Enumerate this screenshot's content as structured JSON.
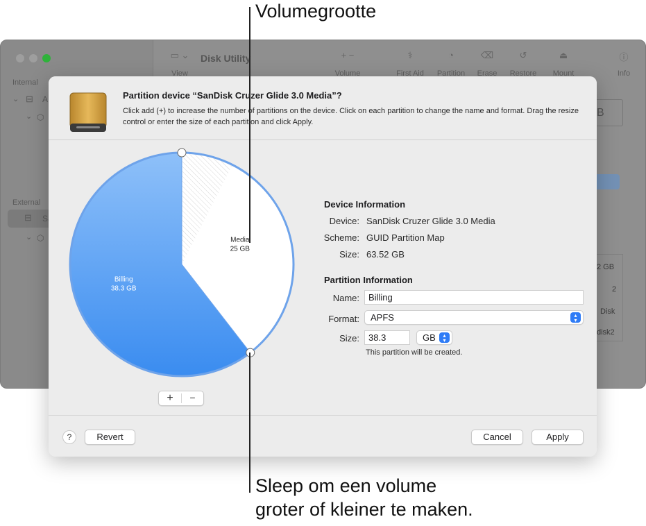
{
  "callouts": {
    "top": "Volumegrootte",
    "bottom_line1": "Sleep om een volume",
    "bottom_line2": "groter of kleiner te maken."
  },
  "background_window": {
    "title": "Disk Utility",
    "toolbar": {
      "view": "View",
      "volume": "Volume",
      "first_aid": "First Aid",
      "partition": "Partition",
      "erase": "Erase",
      "restore": "Restore",
      "mount": "Mount",
      "info": "Info"
    },
    "sidebar": {
      "internal": "Internal",
      "external": "External",
      "internal_item_initial": "A",
      "external_item_initial": "Sa"
    },
    "right_fragments": {
      "box_text": "B",
      "cell1": "2 GB",
      "cell2": "2",
      "cell3": "Disk",
      "cell4": "disk2"
    }
  },
  "sheet": {
    "title": "Partition device “SanDisk Cruzer Glide 3.0 Media”?",
    "description": "Click add (+) to increase the number of partitions on the device. Click on each partition to change the name and format. Drag the resize control or enter the size of each partition and click Apply.",
    "icon": "external-drive-icon",
    "pie": {
      "slices": [
        {
          "name": "Billing",
          "size": "38.3 GB",
          "value": 38.3,
          "color": "#4a96f2"
        },
        {
          "name": "Media",
          "size": "25 GB",
          "value": 25.0,
          "color": "#ffffff"
        }
      ],
      "unallocated_fraction": 0.0
    },
    "add_label": "+",
    "remove_label": "−",
    "device_info": {
      "heading": "Device Information",
      "device_label": "Device:",
      "device_value": "SanDisk Cruzer Glide 3.0 Media",
      "scheme_label": "Scheme:",
      "scheme_value": "GUID Partition Map",
      "size_label": "Size:",
      "size_value": "63.52 GB"
    },
    "partition_info": {
      "heading": "Partition Information",
      "name_label": "Name:",
      "name_value": "Billing",
      "format_label": "Format:",
      "format_value": "APFS",
      "size_label": "Size:",
      "size_value": "38.3",
      "unit_value": "GB",
      "note": "This partition will be created."
    },
    "footer": {
      "help_label": "?",
      "revert_label": "Revert",
      "cancel_label": "Cancel",
      "apply_label": "Apply"
    }
  },
  "colors": {
    "accent": "#2f7cf6",
    "pie_blue": "#4a96f2",
    "pie_border": "#6ea3ea"
  }
}
